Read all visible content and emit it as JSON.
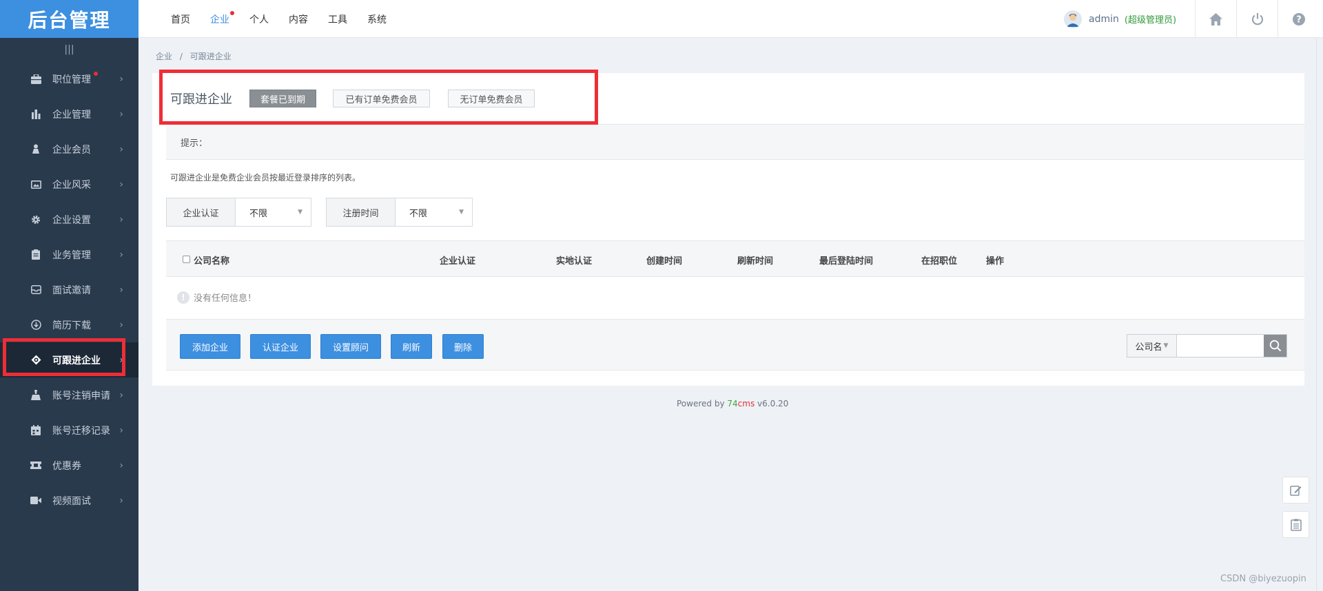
{
  "logo": "后台管理",
  "sidebar": {
    "collapse_icon": "|||",
    "items": [
      {
        "label": "职位管理",
        "icon": "briefcase-icon",
        "dot": true
      },
      {
        "label": "企业管理",
        "icon": "building-icon",
        "dot": false
      },
      {
        "label": "企业会员",
        "icon": "member-icon",
        "dot": false
      },
      {
        "label": "企业风采",
        "icon": "image-icon",
        "dot": false
      },
      {
        "label": "企业设置",
        "icon": "gear-icon",
        "dot": false
      },
      {
        "label": "业务管理",
        "icon": "clipboard-icon",
        "dot": false
      },
      {
        "label": "面试邀请",
        "icon": "inbox-icon",
        "dot": false
      },
      {
        "label": "简历下载",
        "icon": "download-icon",
        "dot": false
      },
      {
        "label": "可跟进企业",
        "icon": "target-icon",
        "dot": false,
        "active": true
      },
      {
        "label": "账号注销申请",
        "icon": "eraser-icon",
        "dot": false
      },
      {
        "label": "账号迁移记录",
        "icon": "calendar-icon",
        "dot": false
      },
      {
        "label": "优惠券",
        "icon": "ticket-icon",
        "dot": false
      },
      {
        "label": "视频面试",
        "icon": "video-icon",
        "dot": false
      }
    ]
  },
  "topnav": {
    "items": [
      {
        "label": "首页"
      },
      {
        "label": "企业",
        "active": true
      },
      {
        "label": "个人"
      },
      {
        "label": "内容"
      },
      {
        "label": "工具"
      },
      {
        "label": "系统"
      }
    ],
    "username": "admin",
    "role": "(超级管理员)"
  },
  "breadcrumb": {
    "root": "企业",
    "sep": "/",
    "current": "可跟进企业"
  },
  "panel": {
    "title": "可跟进企业",
    "subtabs": [
      "套餐已到期",
      "已有订单免费会员",
      "无订单免费会员"
    ],
    "tips_label": "提示：",
    "description": "可跟进企业是免费企业会员按最近登录排序的列表。",
    "filters": [
      {
        "label": "企业认证",
        "value": "不限"
      },
      {
        "label": "注册时间",
        "value": "不限"
      }
    ],
    "columns": [
      "公司名称",
      "企业认证",
      "实地认证",
      "创建时间",
      "刷新时间",
      "最后登陆时间",
      "在招职位",
      "操作"
    ],
    "empty_text": "没有任何信息！",
    "buttons": [
      "添加企业",
      "认证企业",
      "设置顾问",
      "刷新",
      "删除"
    ],
    "search_type": "公司名",
    "search_value": ""
  },
  "powered": {
    "prefix": "Powered by ",
    "brand_a": "74",
    "brand_b": "cms",
    "version": " v6.0.20"
  },
  "watermark": "CSDN @biyezuopin",
  "colors": {
    "primary": "#3d8fe0",
    "sidebar": "#2a3a4d",
    "highlight": "#ee2e36"
  }
}
